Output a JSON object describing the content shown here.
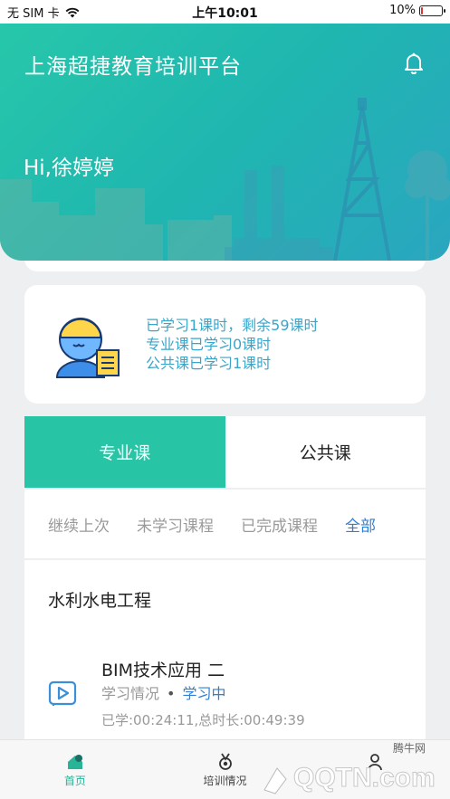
{
  "status_bar": {
    "carrier": "无 SIM 卡",
    "time": "上午10:01",
    "battery": "10%",
    "battery_level": 0.1
  },
  "header": {
    "title": "上海超捷教育培训平台",
    "greeting": "Hi,徐婷婷",
    "notification_icon": "bell-icon"
  },
  "summary": {
    "line1": "已学习1课时，剩余59课时",
    "line2": "专业课已学习0课时",
    "line3": "公共课已学习1课时",
    "avatar_icon": "student-avatar-icon"
  },
  "tabs": [
    {
      "label": "专业课",
      "active": true
    },
    {
      "label": "公共课",
      "active": false
    }
  ],
  "filters": {
    "continue": "继续上次",
    "not_learned": "未学习课程",
    "completed": "已完成课程",
    "all": "全部"
  },
  "course_list": {
    "category": "水利水电工程",
    "items": [
      {
        "title": "BIM技术应用 二",
        "status_label": "学习情况",
        "status_value": "学习中",
        "duration": "已学:00:24:11,总时长:00:49:39",
        "icon": "video-play-icon"
      }
    ]
  },
  "bottom_nav": {
    "home": "首页",
    "training": "培训情况"
  },
  "watermark": {
    "brand": "腾牛网",
    "text": "QQTN.com"
  },
  "colors": {
    "accent": "#27c4a5",
    "link_blue": "#2f7fd4",
    "summary_text": "#3aa5c9"
  }
}
